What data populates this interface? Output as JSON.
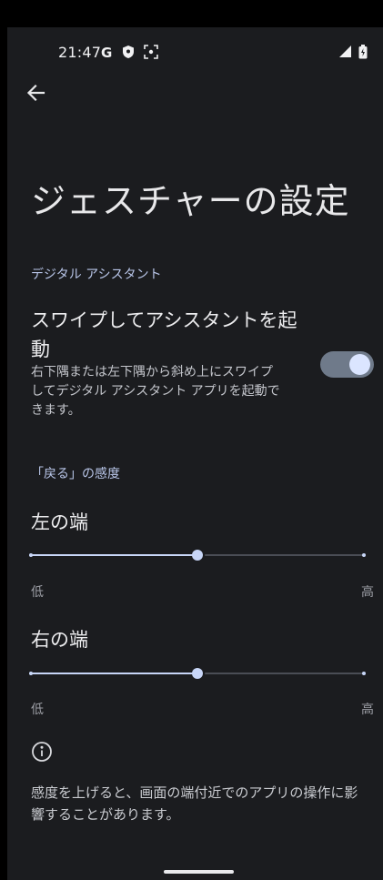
{
  "status_bar": {
    "time": "21:47",
    "icons": [
      "google-g-icon",
      "shield-icon",
      "screenshot-icon",
      "signal-icon",
      "battery-icon"
    ]
  },
  "header": {
    "back_icon": "arrow-back-icon"
  },
  "page": {
    "title": "ジェスチャーの設定"
  },
  "assistant_section": {
    "header": "デジタル アシスタント",
    "setting": {
      "title_line1": "スワイプしてアシスタントを起",
      "title_line2": "動",
      "desc_line1": "右下隅または左下隅から斜め上にスワイプ",
      "desc_line2": "してデジタル アシスタント アプリを起動で",
      "desc_line3": "きます。",
      "enabled": true
    }
  },
  "back_sensitivity": {
    "header": "「戻る」の感度",
    "left_edge": {
      "label": "左の端",
      "low": "低",
      "high": "高",
      "value": 0.5
    },
    "right_edge": {
      "label": "右の端",
      "low": "低",
      "high": "高",
      "value": 0.5
    }
  },
  "footer": {
    "info_icon": "info-icon",
    "text_line1": "感度を上げると、画面の端付近でのアプリの操作に影",
    "text_line2": "響することがあります。"
  },
  "colors": {
    "background": "#1b1c1f",
    "accent": "#c8d6f7",
    "section_header": "#b9c6e9",
    "toggle_track": "#6f7a8a"
  }
}
